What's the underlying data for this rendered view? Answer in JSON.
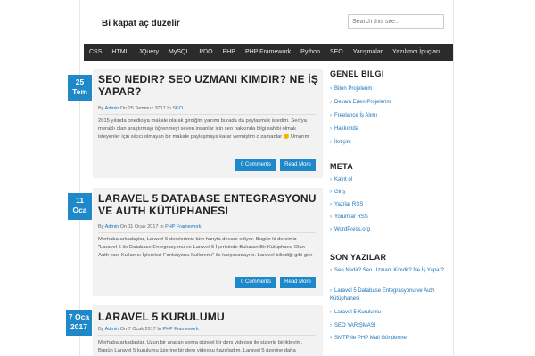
{
  "site": {
    "title": "Bi kapat aç düzelir"
  },
  "search": {
    "placeholder": "Search this site..."
  },
  "nav": [
    "CSS",
    "HTML",
    "JQuery",
    "MySQL",
    "PDO",
    "PHP",
    "PHP Framework",
    "Python",
    "SEO",
    "Yarışmalar",
    "Yazılımcı İpuçları"
  ],
  "posts": [
    {
      "title": "Seo Nedir? Seo Uzmanı Kimdir? Ne İş Yapar?",
      "date_day": "25",
      "date_month": "Tem",
      "date_year": "2017",
      "meta_by": "By",
      "meta_author": "Admin",
      "meta_on": "On 25 Temmuz 2017 In",
      "meta_category": "SEO",
      "excerpt": "2015 yılında onedio'ya makale olarak girdiğim yazımı burada da paylaşmak istedim. Seo'ya meraklı olan araştırmayı öğrenmeyi seven insanlar için seo hakkında bilgi sahibi olmak isteyenler için sıkıcı olmayan bir makale paylaşmaya karar vermiştim o zamanlar",
      "excerpt_end": "Umarım",
      "comments": "0 Comments",
      "more": "Read More"
    },
    {
      "title": "Laravel 5 Database Entegrasyonu ve Auth Kütüphanesi",
      "date_day": "11",
      "date_month": "Oca",
      "date_year": "2017",
      "meta_by": "By",
      "meta_author": "Admin",
      "meta_on": "On 11 Ocak 2017 In",
      "meta_category": "PHP Framework",
      "excerpt": "Merhaba arkadaşlar, Laravel 5 derslerimiz tüm hızıyla devam ediyor. Bugün ki dersimiz \"Laravel 5 ile Database Entegrasyonu ve Laravel 5 İçerisinde Bulunan Bir Kütüphane Olan Auth yani Kullanıcı İşlemleri Fonksiyonu Kullanımı\" ile karşınızdayım. Laravel bilindiği gibi gün",
      "comments": "0 Comments",
      "more": "Read More"
    },
    {
      "title": "Laravel 5 Kurulumu",
      "date_day": "7 Oca",
      "date_month": "2017",
      "meta_by": "By",
      "meta_author": "Admin",
      "meta_on": "On 7 Ocak 2017 In",
      "meta_category": "PHP Framework",
      "excerpt": "Merhaba arkadaşlar, Uzun bir aradan sonra güncel bir ders videosu ile sizlerle birlikteyim. Bugün Laravel 5 kurulumu üzerine bir ders videosu hazırladım. Laravel 5 üzerine daha"
    }
  ],
  "sidebar": {
    "genel_title": "GENEL BILGI",
    "genel_links": [
      "Biten Projelerim",
      "Devam Eden Projelerim",
      "Freelance İş Alımı",
      "Hakkımda",
      "İletişim"
    ],
    "meta_title": "META",
    "meta_links": [
      "Kayıt ol",
      "Giriş",
      "Yazılar RSS",
      "Yorumlar RSS",
      "WordPress.org"
    ],
    "son_title": "SON YAZILAR",
    "son_links": [
      "Seo Nedir? Seo Uzmanı Kimdir? Ne İş Yapar?",
      "Laravel 5 Database Entegrasyonu ve Auth Kütüphanesi",
      "Laravel 5 Kurulumu",
      "SEO YARIŞMASI",
      "SMTP ile PHP Mail Gönderme"
    ]
  },
  "colors": {
    "accent": "#1e88c8",
    "nav_bg": "#2b2b2b",
    "post_bg": "#f2f2f2"
  }
}
